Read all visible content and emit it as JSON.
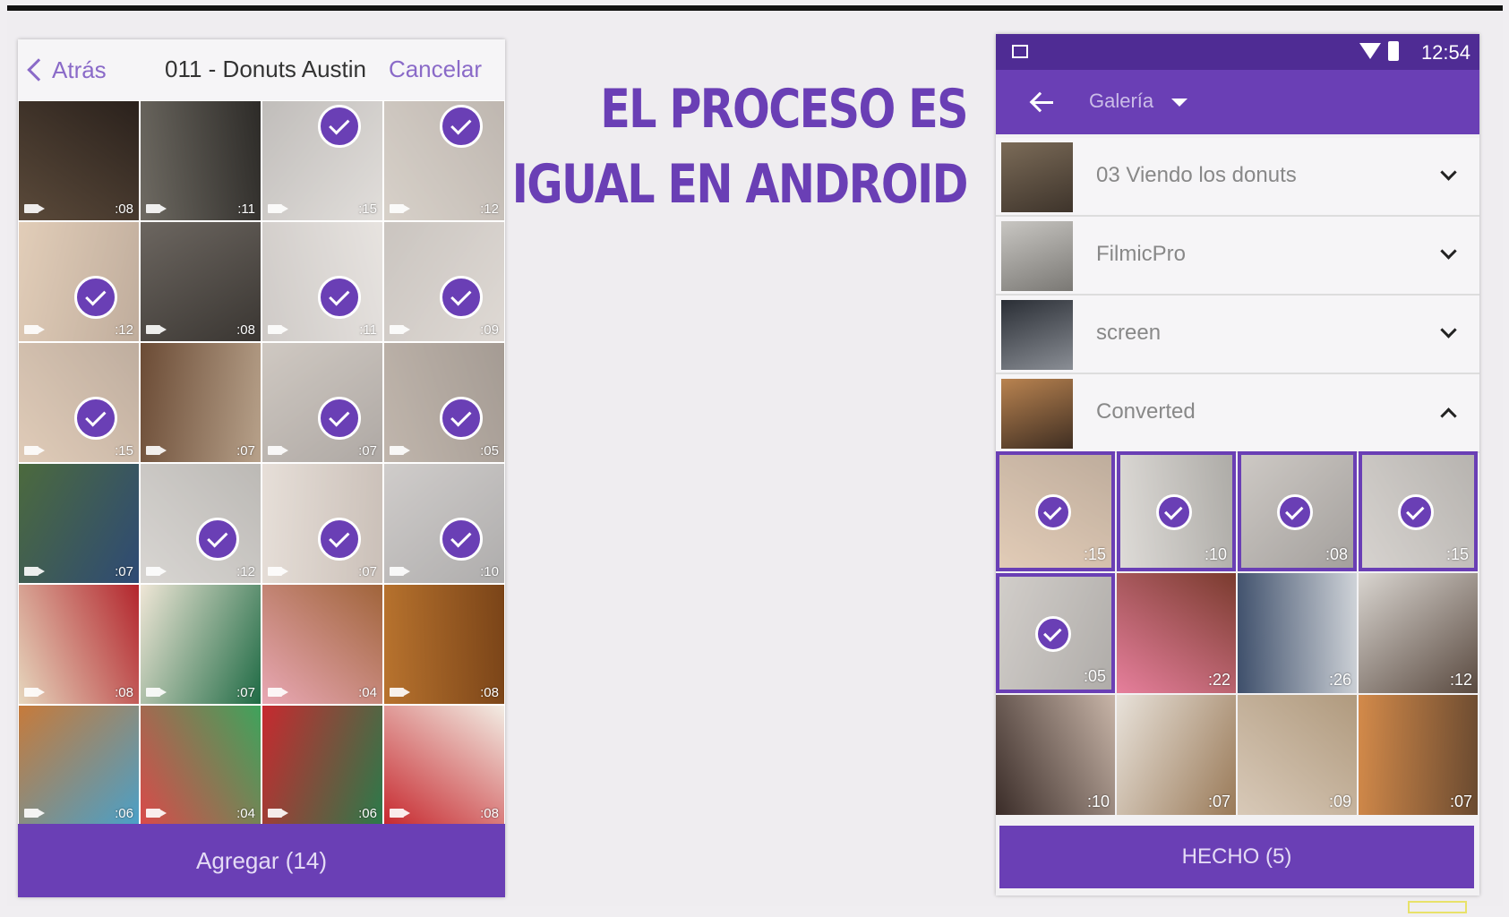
{
  "ios": {
    "back_label": "Atrás",
    "title": "011 - Donuts Austin",
    "cancel_label": "Cancelar",
    "add_label": "Agregar (14)",
    "tiles": [
      {
        "dur": ":08",
        "sel": false,
        "c1": "#5b4a3a",
        "c2": "#2a211c"
      },
      {
        "dur": ":11",
        "sel": false,
        "c1": "#6e6a62",
        "c2": "#2d2b28"
      },
      {
        "dur": ":15",
        "sel": true,
        "c1": "#8d8782",
        "c2": "#c9c3bd"
      },
      {
        "dur": ":12",
        "sel": true,
        "c1": "#b7ab9d",
        "c2": "#8a7c70"
      },
      {
        "dur": ":12",
        "sel": true,
        "c1": "#caa57f",
        "c2": "#8c6a4c"
      },
      {
        "dur": ":08",
        "sel": false,
        "c1": "#6c6660",
        "c2": "#3a3632"
      },
      {
        "dur": ":11",
        "sel": true,
        "c1": "#a8a09a",
        "c2": "#d3ccc6"
      },
      {
        "dur": ":09",
        "sel": true,
        "c1": "#9f958c",
        "c2": "#c4bab1"
      },
      {
        "dur": ":15",
        "sel": true,
        "c1": "#c7a27f",
        "c2": "#8a6b50"
      },
      {
        "dur": ":07",
        "sel": false,
        "c1": "#6b4b35",
        "c2": "#b7a18a"
      },
      {
        "dur": ":07",
        "sel": true,
        "c1": "#a89c90",
        "c2": "#6d625a"
      },
      {
        "dur": ":05",
        "sel": true,
        "c1": "#8d7a69",
        "c2": "#5b4a3c"
      },
      {
        "dur": ":07",
        "sel": false,
        "c1": "#4c6a3d",
        "c2": "#2e4a75"
      },
      {
        "dur": ":12",
        "sel": true,
        "c1": "#b9b4ae",
        "c2": "#858079"
      },
      {
        "dur": ":07",
        "sel": true,
        "c1": "#d2c4b8",
        "c2": "#a08d7f"
      },
      {
        "dur": ":10",
        "sel": true,
        "c1": "#a9a3a0",
        "c2": "#6d6a69"
      },
      {
        "dur": ":08",
        "sel": false,
        "c1": "#e6d7be",
        "c2": "#b3262d"
      },
      {
        "dur": ":07",
        "sel": false,
        "c1": "#efe6d6",
        "c2": "#1f6b45"
      },
      {
        "dur": ":04",
        "sel": false,
        "c1": "#e9a8b5",
        "c2": "#a0643a"
      },
      {
        "dur": ":08",
        "sel": false,
        "c1": "#b8732e",
        "c2": "#7a4418"
      },
      {
        "dur": ":06",
        "sel": false,
        "c1": "#c77a3a",
        "c2": "#4aa0c8"
      },
      {
        "dur": ":04",
        "sel": false,
        "c1": "#d94a4a",
        "c2": "#3fa35c"
      },
      {
        "dur": ":06",
        "sel": false,
        "c1": "#c7292f",
        "c2": "#2b7a4a"
      },
      {
        "dur": ":08",
        "sel": false,
        "c1": "#c7292f",
        "c2": "#f2ede4"
      },
      {
        "dur": "",
        "sel": false,
        "c1": "#b62a2f",
        "c2": "#f1ece3"
      },
      {
        "dur": "",
        "sel": false,
        "c1": "#d9cfc6",
        "c2": "#8a8179"
      },
      {
        "dur": "",
        "sel": false,
        "c1": "#c2bcb6",
        "c2": "#7f7974"
      },
      {
        "dur": "",
        "sel": false,
        "c1": "#9b8f86",
        "c2": "#2e2a28"
      }
    ]
  },
  "headline": {
    "line1": "EL PROCESO ES",
    "line2": "IGUAL EN ANDROID"
  },
  "android": {
    "time": "12:54",
    "gallery_label": "Galería",
    "folders": [
      {
        "name": "03 Viendo los donuts",
        "expanded": false,
        "c1": "#7b6b58",
        "c2": "#3e342b"
      },
      {
        "name": "FilmicPro",
        "expanded": false,
        "c1": "#c8c6c2",
        "c2": "#7a7874"
      },
      {
        "name": "screen",
        "expanded": false,
        "c1": "#2a2e35",
        "c2": "#8a8e95"
      },
      {
        "name": "Converted",
        "expanded": true,
        "c1": "#b98350",
        "c2": "#3f2e22"
      }
    ],
    "tiles": [
      {
        "dur": ":15",
        "sel": true,
        "c1": "#caa27c",
        "c2": "#8a6a4c"
      },
      {
        "dur": ":10",
        "sel": true,
        "c1": "#c2bdb6",
        "c2": "#6c6860"
      },
      {
        "dur": ":08",
        "sel": true,
        "c1": "#a49c94",
        "c2": "#5a534d"
      },
      {
        "dur": ":15",
        "sel": true,
        "c1": "#b5aea7",
        "c2": "#7c766f"
      },
      {
        "dur": ":05",
        "sel": true,
        "c1": "#aca59e",
        "c2": "#6f6963"
      },
      {
        "dur": ":22",
        "sel": false,
        "c1": "#e67f9c",
        "c2": "#7a3b2e"
      },
      {
        "dur": ":26",
        "sel": false,
        "c1": "#3e4f6b",
        "c2": "#cfd3d8"
      },
      {
        "dur": ":12",
        "sel": false,
        "c1": "#d9d5d0",
        "c2": "#5a4a40"
      },
      {
        "dur": ":10",
        "sel": false,
        "c1": "#3a2c28",
        "c2": "#c8b5a8"
      },
      {
        "dur": ":07",
        "sel": false,
        "c1": "#e8e2da",
        "c2": "#9a7a58"
      },
      {
        "dur": ":09",
        "sel": false,
        "c1": "#d8c9b8",
        "c2": "#b09a7e"
      },
      {
        "dur": ":07",
        "sel": false,
        "c1": "#d38a4a",
        "c2": "#6a4a30"
      }
    ],
    "done_label": "HECHO (5)"
  }
}
